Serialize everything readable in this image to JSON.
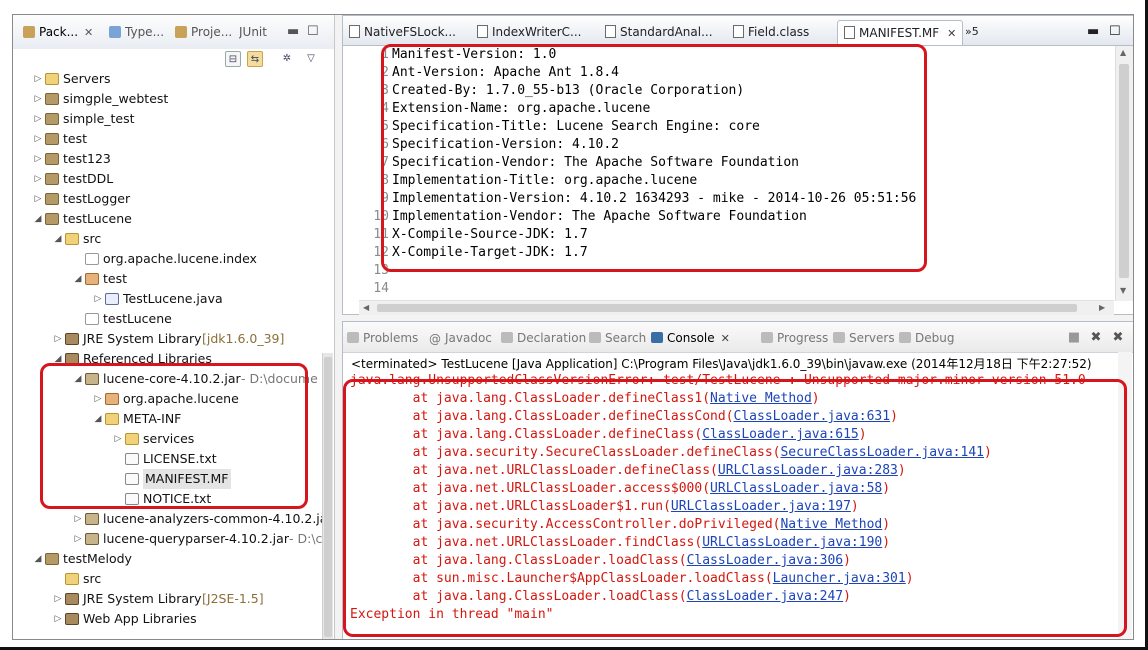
{
  "left_tabs": [
    {
      "label": "Pack...",
      "active": true
    },
    {
      "label": "Type..."
    },
    {
      "label": "Proje..."
    },
    {
      "label": "JUnit"
    }
  ],
  "tree": [
    {
      "label": "Servers",
      "icon": "folder",
      "twisty": "▷",
      "indent": 0
    },
    {
      "label": "simgple_webtest",
      "icon": "proj",
      "twisty": "▷",
      "indent": 0
    },
    {
      "label": "simple_test",
      "icon": "proj",
      "twisty": "▷",
      "indent": 0
    },
    {
      "label": "test",
      "icon": "proj",
      "twisty": "▷",
      "indent": 0
    },
    {
      "label": "test123",
      "icon": "proj",
      "twisty": "▷",
      "indent": 0
    },
    {
      "label": "testDDL",
      "icon": "proj",
      "twisty": "▷",
      "indent": 0
    },
    {
      "label": "testLogger",
      "icon": "proj",
      "twisty": "▷",
      "indent": 0
    },
    {
      "label": "testLucene",
      "icon": "proj",
      "twisty": "◢",
      "indent": 0
    },
    {
      "label": "src",
      "icon": "folder",
      "twisty": "◢",
      "indent": 1
    },
    {
      "label": "org.apache.lucene.index",
      "icon": "pkgd",
      "twisty": "",
      "indent": 2
    },
    {
      "label": "test",
      "icon": "pkg",
      "twisty": "◢",
      "indent": 2
    },
    {
      "label": "TestLucene.java",
      "icon": "java",
      "twisty": "▷",
      "indent": 3
    },
    {
      "label": "testLucene",
      "icon": "pkgd",
      "twisty": "",
      "indent": 2
    },
    {
      "label": "JRE System Library",
      "suffix": " [jdk1.6.0_39]",
      "icon": "lib",
      "twisty": "▷",
      "indent": 1
    },
    {
      "label": "Referenced Libraries",
      "icon": "lib",
      "twisty": "◢",
      "indent": 1
    },
    {
      "label": "lucene-core-4.10.2.jar",
      "suffix": " - D:\\docume",
      "icon": "jar",
      "twisty": "◢",
      "indent": 2
    },
    {
      "label": "org.apache.lucene",
      "icon": "pkg",
      "twisty": "▷",
      "indent": 3
    },
    {
      "label": "META-INF",
      "icon": "folder",
      "twisty": "◢",
      "indent": 3
    },
    {
      "label": "services",
      "icon": "folder",
      "twisty": "▷",
      "indent": 4
    },
    {
      "label": "LICENSE.txt",
      "icon": "file",
      "twisty": "",
      "indent": 4
    },
    {
      "label": "MANIFEST.MF",
      "icon": "file",
      "twisty": "",
      "indent": 4,
      "selected": true
    },
    {
      "label": "NOTICE.txt",
      "icon": "file",
      "twisty": "",
      "indent": 4
    },
    {
      "label": "lucene-analyzers-common-4.10.2.ja",
      "icon": "jar",
      "twisty": "▷",
      "indent": 2
    },
    {
      "label": "lucene-queryparser-4.10.2.jar",
      "suffix": " - D:\\c",
      "icon": "jar",
      "twisty": "▷",
      "indent": 2
    },
    {
      "label": "testMelody",
      "icon": "proj",
      "twisty": "◢",
      "indent": 0
    },
    {
      "label": "src",
      "icon": "folder",
      "twisty": "",
      "indent": 1
    },
    {
      "label": "JRE System Library",
      "suffix": " [J2SE-1.5]",
      "icon": "lib",
      "twisty": "▷",
      "indent": 1
    },
    {
      "label": "Web App Libraries",
      "icon": "lib",
      "twisty": "▷",
      "indent": 1
    }
  ],
  "editor_tabs": [
    {
      "label": "NativeFSLock..."
    },
    {
      "label": "IndexWriterC..."
    },
    {
      "label": "StandardAnal..."
    },
    {
      "label": "Field.class"
    },
    {
      "label": "MANIFEST.MF",
      "active": true
    }
  ],
  "editor_overflow": "»5",
  "manifest_lines": [
    "Manifest-Version: 1.0",
    "Ant-Version: Apache Ant 1.8.4",
    "Created-By: 1.7.0_55-b13 (Oracle Corporation)",
    "Extension-Name: org.apache.lucene",
    "Specification-Title: Lucene Search Engine: core",
    "Specification-Version: 4.10.2",
    "Specification-Vendor: The Apache Software Foundation",
    "Implementation-Title: org.apache.lucene",
    "Implementation-Version: 4.10.2 1634293 - mike - 2014-10-26 05:51:56",
    "Implementation-Vendor: The Apache Software Foundation",
    "X-Compile-Source-JDK: 1.7",
    "X-Compile-Target-JDK: 1.7",
    "",
    ""
  ],
  "console_tabs": [
    {
      "label": "Problems"
    },
    {
      "label": "Javadoc"
    },
    {
      "label": "Declaration"
    },
    {
      "label": "Search"
    },
    {
      "label": "Console",
      "active": true
    },
    {
      "label": "Progress"
    },
    {
      "label": "Servers"
    },
    {
      "label": "Debug"
    }
  ],
  "terminated": "<terminated> TestLucene [Java Application] C:\\Program Files\\Java\\jdk1.6.0_39\\bin\\javaw.exe (2014年12月18日 下午2:27:52)",
  "console_lines": [
    {
      "pre": "java.lang.UnsupportedClassVersionError: test/TestLucene : Unsupported major.minor version 51.0",
      "link": "",
      "post": ""
    },
    {
      "pre": "\tat java.lang.ClassLoader.defineClass1(",
      "link": "Native Method",
      "post": ")"
    },
    {
      "pre": "\tat java.lang.ClassLoader.defineClassCond(",
      "link": "ClassLoader.java:631",
      "post": ")"
    },
    {
      "pre": "\tat java.lang.ClassLoader.defineClass(",
      "link": "ClassLoader.java:615",
      "post": ")"
    },
    {
      "pre": "\tat java.security.SecureClassLoader.defineClass(",
      "link": "SecureClassLoader.java:141",
      "post": ")"
    },
    {
      "pre": "\tat java.net.URLClassLoader.defineClass(",
      "link": "URLClassLoader.java:283",
      "post": ")"
    },
    {
      "pre": "\tat java.net.URLClassLoader.access$000(",
      "link": "URLClassLoader.java:58",
      "post": ")"
    },
    {
      "pre": "\tat java.net.URLClassLoader$1.run(",
      "link": "URLClassLoader.java:197",
      "post": ")"
    },
    {
      "pre": "\tat java.security.AccessController.doPrivileged(",
      "link": "Native Method",
      "post": ")"
    },
    {
      "pre": "\tat java.net.URLClassLoader.findClass(",
      "link": "URLClassLoader.java:190",
      "post": ")"
    },
    {
      "pre": "\tat java.lang.ClassLoader.loadClass(",
      "link": "ClassLoader.java:306",
      "post": ")"
    },
    {
      "pre": "\tat sun.misc.Launcher$AppClassLoader.loadClass(",
      "link": "Launcher.java:301",
      "post": ")"
    },
    {
      "pre": "\tat java.lang.ClassLoader.loadClass(",
      "link": "ClassLoader.java:247",
      "post": ")"
    },
    {
      "pre": "Exception in thread \"main\"",
      "link": "",
      "post": ""
    }
  ],
  "colors": {
    "error_text": "#d3170f",
    "link_text": "#1d44b8",
    "highlight_box": "#d6151c"
  }
}
